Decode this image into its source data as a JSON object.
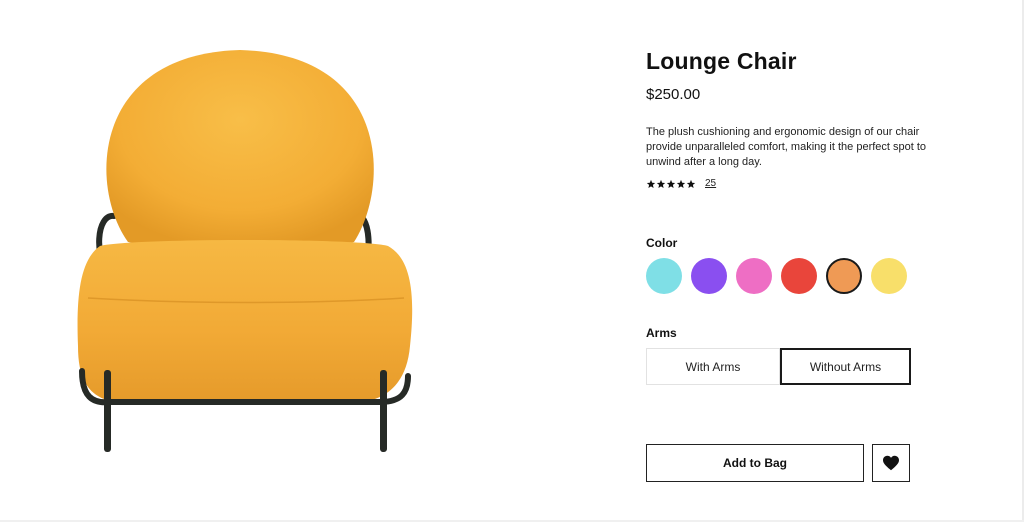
{
  "product": {
    "title": "Lounge Chair",
    "price": "$250.00",
    "description": "The plush cushioning and ergonomic design of our chair provide unparalleled comfort, making it the perfect spot to unwind after a long day.",
    "rating": {
      "stars": 5,
      "max": 5,
      "review_count": "25"
    },
    "image_icon": "lounge-chair-image"
  },
  "color_section": {
    "label": "Color",
    "selected": "orange",
    "options": [
      {
        "name": "cyan",
        "hex": "#7fdfe6"
      },
      {
        "name": "purple",
        "hex": "#8a4ff0"
      },
      {
        "name": "pink",
        "hex": "#ee6ec4"
      },
      {
        "name": "red",
        "hex": "#e9453b"
      },
      {
        "name": "orange",
        "hex": "#ef9a55"
      },
      {
        "name": "yellow",
        "hex": "#f8df6a"
      }
    ]
  },
  "arms_section": {
    "label": "Arms",
    "options": [
      "With Arms",
      "Without Arms"
    ],
    "selected": "Without Arms"
  },
  "actions": {
    "add_to_bag_label": "Add to Bag",
    "wishlist_icon": "heart-icon"
  },
  "colors": {
    "chair_fabric": "#f6b43e",
    "chair_frame": "#262a26",
    "accent_dark": "#1a1a1a"
  }
}
